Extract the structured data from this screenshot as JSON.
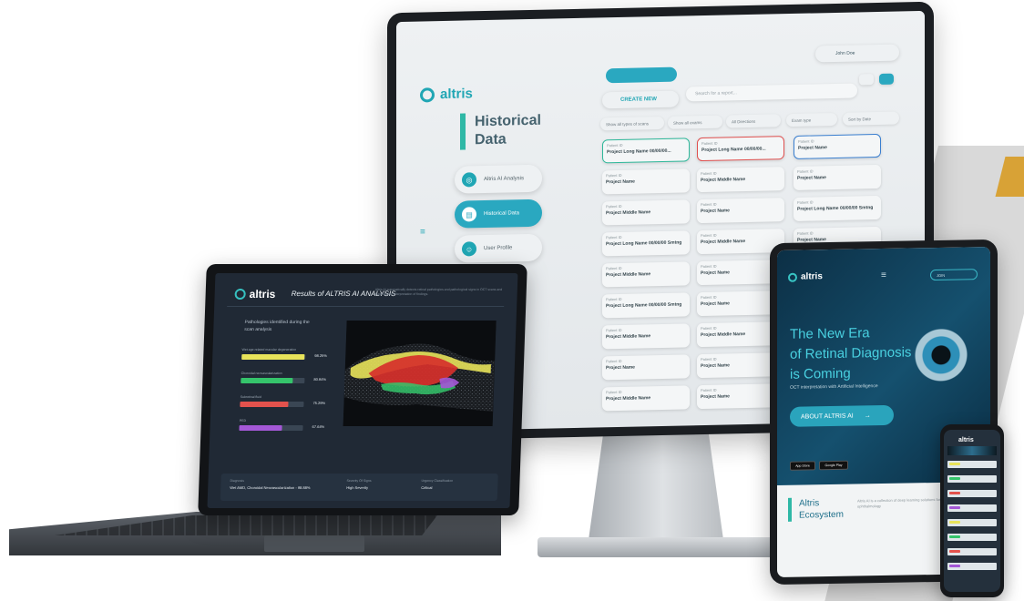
{
  "colors": {
    "accent": "#20a6b4",
    "teal": "#2fb8a6",
    "highlight": "#49d0e0",
    "bar_yellow": "#e8e35a",
    "bar_green": "#35c46b",
    "bar_red": "#e3524d",
    "bar_purple": "#a458d6"
  },
  "monitor": {
    "logo": "altris",
    "page_title_line1": "Historical",
    "page_title_line2": "Data",
    "nav": [
      {
        "label": "Altris AI Analysis",
        "icon": "analysis-icon"
      },
      {
        "label": "Historical Data",
        "icon": "folder-icon"
      },
      {
        "label": "User Profile",
        "icon": "user-icon"
      }
    ],
    "create_button": "CREATE NEW",
    "search_placeholder": "Search for a report...",
    "user_name": "John Doe",
    "filters": [
      "Show all types of scans",
      "Show all exams",
      "All Directions",
      "Exam type",
      "Sort by Date"
    ],
    "card_id_label": "Patient ID",
    "cards": [
      "Project Long Name 00/00/00...",
      "Project Long Name 00/00/00...",
      "Project Name",
      "Project Name",
      "Project Middle Name",
      "Project Name",
      "Project Middle Name",
      "Project Name",
      "Project Long Name 00/00/00 Smtng",
      "Project Long Name 00/00/00 Smtng",
      "Project Middle Name",
      "Project Name",
      "Project Middle Name",
      "Project Name",
      "Project Name",
      "Project Long Name 00/00/00 Smtng",
      "Project Name",
      "Project Name",
      "Project Middle Name",
      "Project Middle Name",
      "Project Name",
      "Project Name",
      "Project Name",
      "Project Name",
      "Project Middle Name",
      "Project Name",
      "Project Name"
    ]
  },
  "laptop": {
    "logo": "altris",
    "header": "Results of ALTRIS AI ANALYSIS",
    "description": "Altris AI automatically detects retinal pathologies and pathological signs in OCT scans and supports the interpretation of findings.",
    "intro": "Pathologies identified during the scan analysis",
    "findings": [
      {
        "label": "Wet age-related macular degeneration",
        "value": 0.9825,
        "pct": "98.25%",
        "color": "#e8e35a"
      },
      {
        "label": "Choroidal neovascularization",
        "value": 0.8094,
        "pct": "80.94%",
        "color": "#35c46b"
      },
      {
        "label": "Subretinal fluid",
        "value": 0.7529,
        "pct": "75.29%",
        "color": "#e3524d"
      },
      {
        "label": "PED",
        "value": 0.6764,
        "pct": "67.64%",
        "color": "#a458d6"
      }
    ],
    "footer": {
      "diagnosis_label": "Diagnosis",
      "diagnosis_value": "Wet AMD, Choroidal Neovascularization - 98.88%",
      "severity_label": "Severity Of Signs",
      "severity_value": "High Severity",
      "urgency_label": "Urgency Classification",
      "urgency_value": "Critical"
    }
  },
  "tablet": {
    "logo": "altris",
    "join_label": "JOIN",
    "hero_line1": "The New Era",
    "hero_line2": "of Retinal Diagnosis",
    "hero_line3": "is Coming",
    "hero_sub": "OCT interpretation with Artificial Intelligence",
    "cta": "ABOUT ALTRIS AI",
    "store_apple": "App Store",
    "store_google": "Google Play",
    "eco_line1": "Altris",
    "eco_line2": "Ecosystem",
    "eco_text": "Altris AI is a collection of deep learning solutions for ophthalmology"
  },
  "phone": {
    "logo": "altris"
  }
}
